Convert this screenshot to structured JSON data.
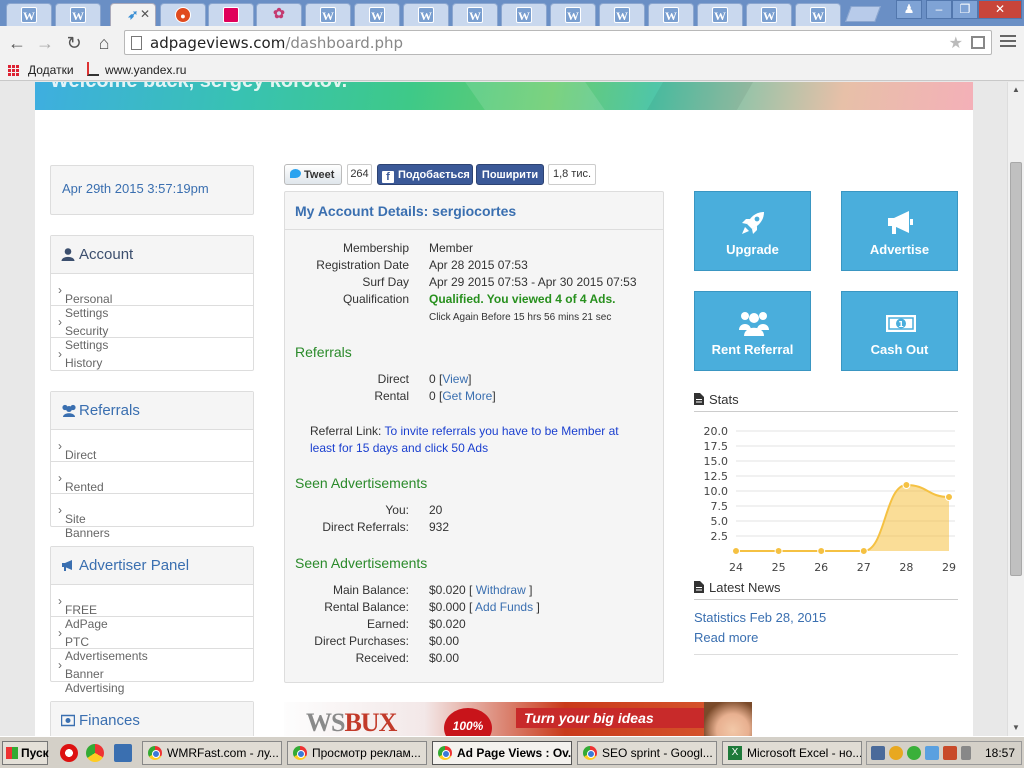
{
  "browser": {
    "tab_letter": "W",
    "url_host": "adpageviews.com",
    "url_path": "/dashboard.php",
    "bookmarks": [
      "Додатки",
      "www.yandex.ru"
    ],
    "window_buttons": {
      "user": "♟",
      "minimize": "–",
      "restore": "❐",
      "close": "✕"
    }
  },
  "page": {
    "welcome": "Welcome back, sergey korotov.",
    "date": "Apr 29th 2015 3:57:19pm"
  },
  "sidebar": {
    "account": {
      "title": "Account",
      "items": [
        "Personal Settings",
        "Security Settings",
        "History"
      ]
    },
    "referrals": {
      "title": "Referrals",
      "items": [
        "Direct",
        "Rented",
        "Site Banners"
      ]
    },
    "advertiser": {
      "title": "Advertiser Panel",
      "items": [
        "FREE AdPage",
        "PTC Advertisements",
        "Banner Advertising"
      ]
    },
    "finances": {
      "title": "Finances"
    }
  },
  "social": {
    "tweet": "Tweet",
    "tweet_count": "264",
    "like": "Подобається",
    "share": "Поширити",
    "share_count": "1,8 тис."
  },
  "details": {
    "title": "My Account Details: sergiocortes",
    "membership_label": "Membership",
    "membership": "Member",
    "registration_label": "Registration Date",
    "registration": "Apr 28 2015 07:53",
    "surf_label": "Surf Day",
    "surf": "Apr 29 2015 07:53 - Apr 30 2015 07:53",
    "qualification_label": "Qualification",
    "qualification": "Qualified. You viewed 4 of 4 Ads.",
    "click_again": "Click Again Before 15 hrs 56 mins 21 sec",
    "referrals_title": "Referrals",
    "direct_label": "Direct",
    "direct_value": "0 [",
    "direct_link": "View",
    "direct_close": "]",
    "rental_label": "Rental",
    "rental_value": "0 [",
    "rental_link": "Get More",
    "rental_close": "]",
    "reflink_label": "Referral Link:",
    "reflink_text": "To invite referrals you have to be Member at least for 15 days and click 50 Ads",
    "seen_title": "Seen Advertisements",
    "you_label": "You:",
    "you_value": "20",
    "direct_refs_label": "Direct Referrals:",
    "direct_refs_value": "932",
    "seen_title2": "Seen Advertisements",
    "main_balance_label": "Main Balance:",
    "main_balance": "$0.020 [",
    "withdraw": "Withdraw",
    "main_close": "]",
    "rental_balance_label": "Rental Balance:",
    "rental_balance": "$0.000 [",
    "add_funds": "Add Funds",
    "rental_close2": "]",
    "earned_label": "Earned:",
    "earned": "$0.020",
    "direct_purchases_label": "Direct Purchases:",
    "direct_purchases": "$0.00",
    "received_label": "Received:",
    "received": "$0.00"
  },
  "actions": {
    "upgrade": "Upgrade",
    "advertise": "Advertise",
    "rent_referral": "Rent Referral",
    "cash_out": "Cash Out"
  },
  "stats": {
    "title": "Stats"
  },
  "chart_data": {
    "type": "area",
    "title": "Stats",
    "x": [
      24,
      25,
      26,
      27,
      28,
      29
    ],
    "series": [
      {
        "values": [
          0,
          0,
          0,
          0,
          11,
          9
        ]
      }
    ],
    "ylim": [
      0,
      20
    ],
    "yticks": [
      "20.0",
      "17.5",
      "15.0",
      "12.5",
      "10.0",
      "7.5",
      "5.0",
      "2.5"
    ],
    "color": "#f5c142"
  },
  "news": {
    "title": "Latest News",
    "item": "Statistics Feb 28, 2015",
    "read_more": "Read more"
  },
  "ad": {
    "logo_a": "WS",
    "logo_b": "BUX",
    "badge": "100%",
    "slogan": "Turn your big ideas"
  },
  "taskbar": {
    "start": "Пуск",
    "tasks": [
      "WMRFast.com - лу...",
      "Просмотр реклам...",
      "Ad Page Views : Ov...",
      "SEO sprint - Googl...",
      "Microsoft Excel - но..."
    ],
    "clock": "18:57"
  }
}
